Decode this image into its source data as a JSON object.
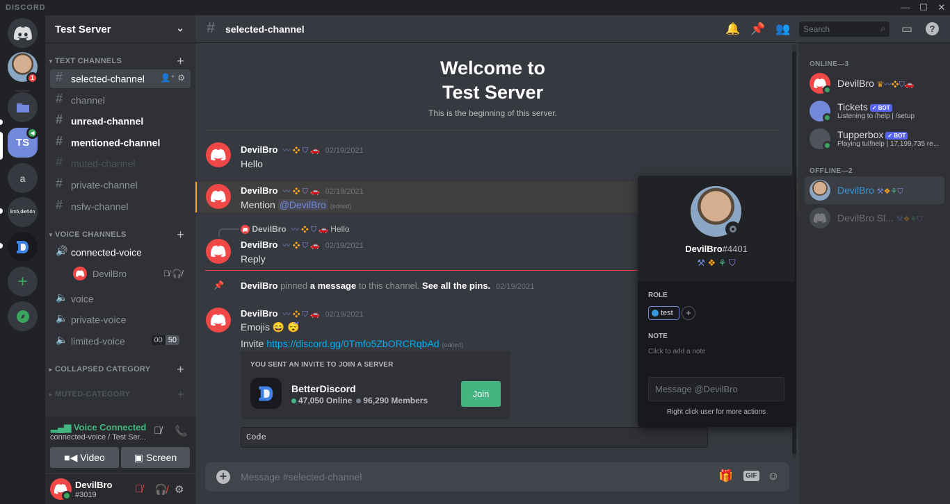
{
  "titlebar": {
    "brand": "DISCORD",
    "min": "—",
    "max": "☐",
    "close": "✕"
  },
  "guilds": [
    {
      "label": "TS"
    },
    {
      "label": "a"
    },
    {
      "label": "lim5,die5ön"
    }
  ],
  "home_mention_count": "1",
  "server": {
    "name": "Test Server",
    "chevron": "⌄"
  },
  "categories": {
    "text": "TEXT CHANNELS",
    "voice": "VOICE CHANNELS",
    "collapsed": "COLLAPSED CATEGORY",
    "muted": "MUTED-CATEGORY"
  },
  "channels": {
    "selected": "selected-channel",
    "channel": "channel",
    "unread": "unread-channel",
    "mentioned": "mentioned-channel",
    "muted": "muted-channel",
    "private": "private-channel",
    "nsfw": "nsfw-channel"
  },
  "voice_channels": {
    "connected": "connected-voice",
    "connected_user": "DevilBro",
    "voice": "voice",
    "private": "private-voice",
    "limited": "limited-voice",
    "limit_current": "00",
    "limit_max": "50"
  },
  "voice_panel": {
    "status": "Voice Connected",
    "sub": "connected-voice / Test Ser...",
    "video": "Video",
    "screen": "Screen"
  },
  "user": {
    "name": "DevilBro",
    "tag": "#3019"
  },
  "chat": {
    "channel_name": "selected-channel",
    "search_placeholder": "Search",
    "welcome_line1": "Welcome to",
    "welcome_line2": "Test Server",
    "welcome_sub": "This is the beginning of this server.",
    "composer_placeholder": "Message #selected-channel",
    "gif": "GIF"
  },
  "messages": [
    {
      "author": "DevilBro",
      "time": "02/19/2021",
      "text": "Hello"
    },
    {
      "author": "DevilBro",
      "time": "02/19/2021",
      "text_prefix": "Mention ",
      "mention": "@DevilBro",
      "edited": "(edited)"
    },
    {
      "author": "DevilBro",
      "time": "02/19/2021",
      "text": "Reply",
      "reply_author": "DevilBro",
      "reply_text": "Hello"
    },
    {
      "author": "DevilBro",
      "time": "02/19/2021",
      "text": "Emojis 😄 😴",
      "invite_prefix": "Invite ",
      "invite_link": "https://discord.gg/0Tmfo5ZbORCRqbAd",
      "edited": "(edited)"
    }
  ],
  "pin": {
    "author": "DevilBro",
    "pinned": " pinned ",
    "a_message": "a message",
    "to_channel": " to this channel. ",
    "see_all": "See all the pins.",
    "time": "02/19/2021"
  },
  "invite": {
    "header": "YOU SENT AN INVITE TO JOIN A SERVER",
    "name": "BetterDiscord",
    "online": "47,050 Online",
    "members": "96,290 Members",
    "join": "Join"
  },
  "code": "Code",
  "popout": {
    "name": "DevilBro",
    "disc": "#4401",
    "role_header": "ROLE",
    "role": "test",
    "note_header": "NOTE",
    "note_placeholder": "Click to add a note",
    "message_placeholder": "Message @DevilBro",
    "hint": "Right click user for more actions"
  },
  "members": {
    "online_header": "ONLINE—3",
    "offline_header": "OFFLINE—2",
    "online": [
      {
        "name": "DevilBro",
        "sub": ""
      },
      {
        "name": "Tickets",
        "sub": "Listening to /help | /setup",
        "bot": "✓ BOT"
      },
      {
        "name": "Tupperbox",
        "sub": "Playing tul!help | 17,199,735 re...",
        "bot": "✓ BOT"
      }
    ],
    "offline": [
      {
        "name": "DevilBro"
      },
      {
        "name": "DevilBro Sl..."
      }
    ]
  },
  "colors": {
    "accent": "#7289da",
    "online": "#43b581",
    "danger": "#f04747",
    "mention": "#faa61a"
  }
}
